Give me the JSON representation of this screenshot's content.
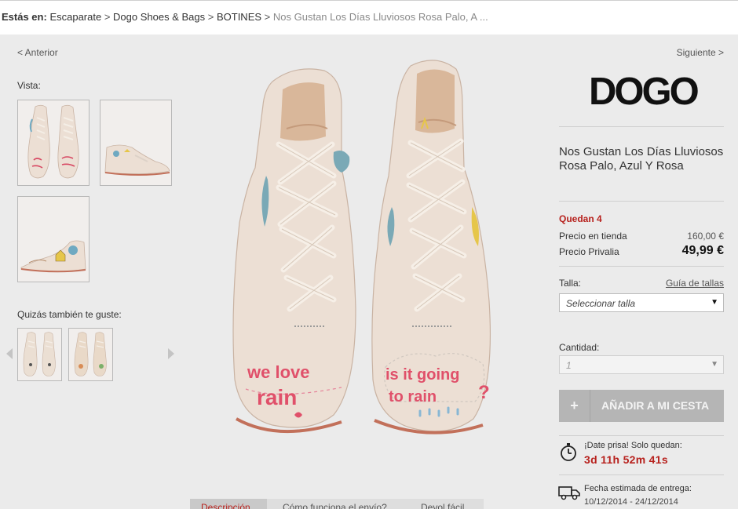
{
  "breadcrumb": {
    "label": "Estás en:",
    "items": [
      "Escaparate",
      "Dogo Shoes & Bags",
      "BOTINES"
    ],
    "separator": ">",
    "current": "Nos Gustan Los Días Lluviosos Rosa Palo, A ..."
  },
  "nav": {
    "prev": "< Anterior",
    "next": "Siguiente >"
  },
  "gallery": {
    "vista_label": "Vista:",
    "recommend_label": "Quizás también te guste:"
  },
  "product_image": {
    "left_text_1": "we love",
    "left_text_2": "rain",
    "right_text_1": "is it going",
    "right_text_2": "to rain",
    "right_text_3": "?"
  },
  "brand": {
    "logo_text": "DOGO",
    "reg_mark": "®"
  },
  "product": {
    "title": "Nos Gustan Los Días Lluviosos Rosa Palo, Azul Y Rosa",
    "stock_text": "Quedan 4",
    "store_price_label": "Precio en tienda",
    "store_price": "160,00 €",
    "privalia_price_label": "Precio Privalia",
    "privalia_price": "49,99 €"
  },
  "size": {
    "label": "Talla:",
    "guide_link": "Guía de tallas",
    "selected": "Seleccionar talla"
  },
  "quantity": {
    "label": "Cantidad:",
    "selected": "1"
  },
  "cart": {
    "plus": "+",
    "add_label": "AÑADIR A MI CESTA"
  },
  "countdown": {
    "text": "¡Date prisa! Solo quedan:",
    "value": "3d 11h 52m 41s"
  },
  "delivery": {
    "text": "Fecha estimada de entrega:",
    "value": "10/12/2014 - 24/12/2014"
  },
  "tabs": [
    "Descripción",
    "Cómo funciona el envío?",
    "Devol fácil"
  ],
  "colors": {
    "accent_red": "#b7211d",
    "shoe_body": "#ede2d8",
    "shoe_text": "#e0506a",
    "button_gray": "#b5b5b5"
  },
  "icons": {
    "timer": "stopwatch-icon",
    "truck": "truck-icon",
    "caret": "▼"
  }
}
